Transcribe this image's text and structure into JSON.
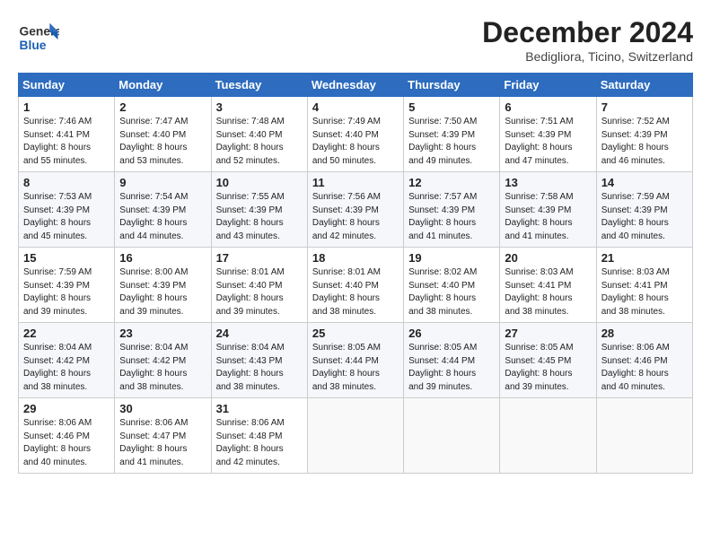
{
  "header": {
    "logo_line1": "General",
    "logo_line2": "Blue",
    "month_title": "December 2024",
    "subtitle": "Bedigliora, Ticino, Switzerland"
  },
  "days_of_week": [
    "Sunday",
    "Monday",
    "Tuesday",
    "Wednesday",
    "Thursday",
    "Friday",
    "Saturday"
  ],
  "weeks": [
    [
      {
        "day": "1",
        "lines": [
          "Sunrise: 7:46 AM",
          "Sunset: 4:41 PM",
          "Daylight: 8 hours",
          "and 55 minutes."
        ]
      },
      {
        "day": "2",
        "lines": [
          "Sunrise: 7:47 AM",
          "Sunset: 4:40 PM",
          "Daylight: 8 hours",
          "and 53 minutes."
        ]
      },
      {
        "day": "3",
        "lines": [
          "Sunrise: 7:48 AM",
          "Sunset: 4:40 PM",
          "Daylight: 8 hours",
          "and 52 minutes."
        ]
      },
      {
        "day": "4",
        "lines": [
          "Sunrise: 7:49 AM",
          "Sunset: 4:40 PM",
          "Daylight: 8 hours",
          "and 50 minutes."
        ]
      },
      {
        "day": "5",
        "lines": [
          "Sunrise: 7:50 AM",
          "Sunset: 4:39 PM",
          "Daylight: 8 hours",
          "and 49 minutes."
        ]
      },
      {
        "day": "6",
        "lines": [
          "Sunrise: 7:51 AM",
          "Sunset: 4:39 PM",
          "Daylight: 8 hours",
          "and 47 minutes."
        ]
      },
      {
        "day": "7",
        "lines": [
          "Sunrise: 7:52 AM",
          "Sunset: 4:39 PM",
          "Daylight: 8 hours",
          "and 46 minutes."
        ]
      }
    ],
    [
      {
        "day": "8",
        "lines": [
          "Sunrise: 7:53 AM",
          "Sunset: 4:39 PM",
          "Daylight: 8 hours",
          "and 45 minutes."
        ]
      },
      {
        "day": "9",
        "lines": [
          "Sunrise: 7:54 AM",
          "Sunset: 4:39 PM",
          "Daylight: 8 hours",
          "and 44 minutes."
        ]
      },
      {
        "day": "10",
        "lines": [
          "Sunrise: 7:55 AM",
          "Sunset: 4:39 PM",
          "Daylight: 8 hours",
          "and 43 minutes."
        ]
      },
      {
        "day": "11",
        "lines": [
          "Sunrise: 7:56 AM",
          "Sunset: 4:39 PM",
          "Daylight: 8 hours",
          "and 42 minutes."
        ]
      },
      {
        "day": "12",
        "lines": [
          "Sunrise: 7:57 AM",
          "Sunset: 4:39 PM",
          "Daylight: 8 hours",
          "and 41 minutes."
        ]
      },
      {
        "day": "13",
        "lines": [
          "Sunrise: 7:58 AM",
          "Sunset: 4:39 PM",
          "Daylight: 8 hours",
          "and 41 minutes."
        ]
      },
      {
        "day": "14",
        "lines": [
          "Sunrise: 7:59 AM",
          "Sunset: 4:39 PM",
          "Daylight: 8 hours",
          "and 40 minutes."
        ]
      }
    ],
    [
      {
        "day": "15",
        "lines": [
          "Sunrise: 7:59 AM",
          "Sunset: 4:39 PM",
          "Daylight: 8 hours",
          "and 39 minutes."
        ]
      },
      {
        "day": "16",
        "lines": [
          "Sunrise: 8:00 AM",
          "Sunset: 4:39 PM",
          "Daylight: 8 hours",
          "and 39 minutes."
        ]
      },
      {
        "day": "17",
        "lines": [
          "Sunrise: 8:01 AM",
          "Sunset: 4:40 PM",
          "Daylight: 8 hours",
          "and 39 minutes."
        ]
      },
      {
        "day": "18",
        "lines": [
          "Sunrise: 8:01 AM",
          "Sunset: 4:40 PM",
          "Daylight: 8 hours",
          "and 38 minutes."
        ]
      },
      {
        "day": "19",
        "lines": [
          "Sunrise: 8:02 AM",
          "Sunset: 4:40 PM",
          "Daylight: 8 hours",
          "and 38 minutes."
        ]
      },
      {
        "day": "20",
        "lines": [
          "Sunrise: 8:03 AM",
          "Sunset: 4:41 PM",
          "Daylight: 8 hours",
          "and 38 minutes."
        ]
      },
      {
        "day": "21",
        "lines": [
          "Sunrise: 8:03 AM",
          "Sunset: 4:41 PM",
          "Daylight: 8 hours",
          "and 38 minutes."
        ]
      }
    ],
    [
      {
        "day": "22",
        "lines": [
          "Sunrise: 8:04 AM",
          "Sunset: 4:42 PM",
          "Daylight: 8 hours",
          "and 38 minutes."
        ]
      },
      {
        "day": "23",
        "lines": [
          "Sunrise: 8:04 AM",
          "Sunset: 4:42 PM",
          "Daylight: 8 hours",
          "and 38 minutes."
        ]
      },
      {
        "day": "24",
        "lines": [
          "Sunrise: 8:04 AM",
          "Sunset: 4:43 PM",
          "Daylight: 8 hours",
          "and 38 minutes."
        ]
      },
      {
        "day": "25",
        "lines": [
          "Sunrise: 8:05 AM",
          "Sunset: 4:44 PM",
          "Daylight: 8 hours",
          "and 38 minutes."
        ]
      },
      {
        "day": "26",
        "lines": [
          "Sunrise: 8:05 AM",
          "Sunset: 4:44 PM",
          "Daylight: 8 hours",
          "and 39 minutes."
        ]
      },
      {
        "day": "27",
        "lines": [
          "Sunrise: 8:05 AM",
          "Sunset: 4:45 PM",
          "Daylight: 8 hours",
          "and 39 minutes."
        ]
      },
      {
        "day": "28",
        "lines": [
          "Sunrise: 8:06 AM",
          "Sunset: 4:46 PM",
          "Daylight: 8 hours",
          "and 40 minutes."
        ]
      }
    ],
    [
      {
        "day": "29",
        "lines": [
          "Sunrise: 8:06 AM",
          "Sunset: 4:46 PM",
          "Daylight: 8 hours",
          "and 40 minutes."
        ]
      },
      {
        "day": "30",
        "lines": [
          "Sunrise: 8:06 AM",
          "Sunset: 4:47 PM",
          "Daylight: 8 hours",
          "and 41 minutes."
        ]
      },
      {
        "day": "31",
        "lines": [
          "Sunrise: 8:06 AM",
          "Sunset: 4:48 PM",
          "Daylight: 8 hours",
          "and 42 minutes."
        ]
      },
      null,
      null,
      null,
      null
    ]
  ]
}
